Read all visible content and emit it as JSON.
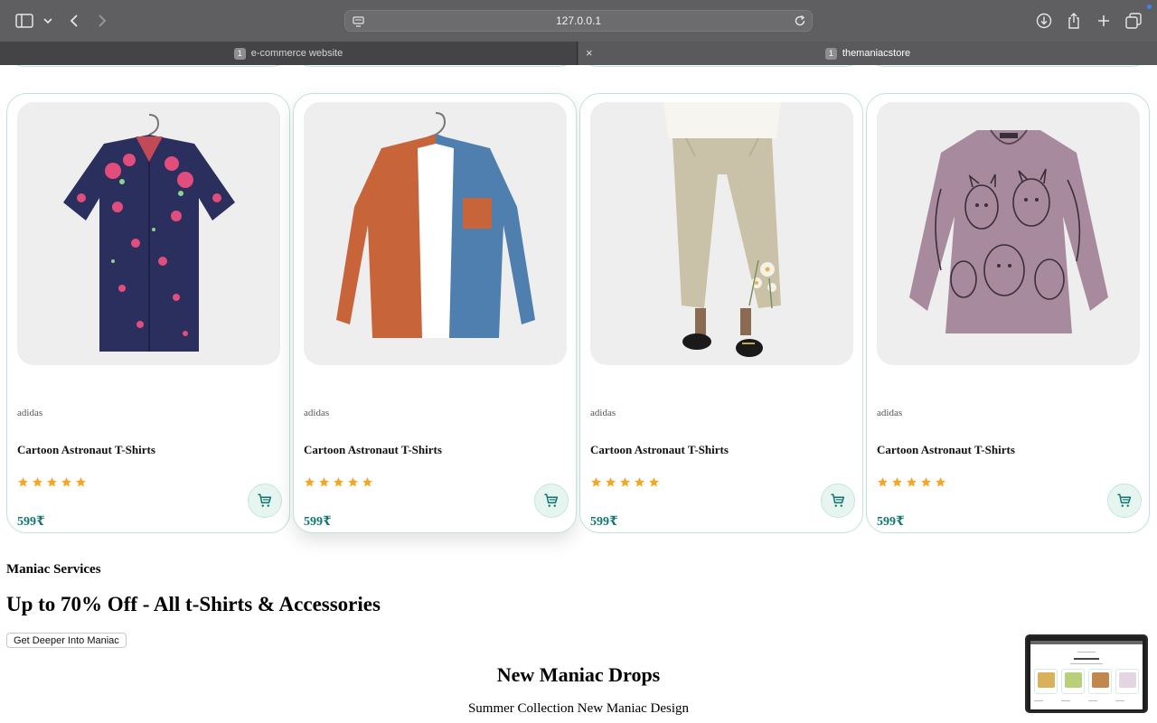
{
  "browser": {
    "url": "127.0.0.1",
    "tabs": [
      {
        "number": "1",
        "label": "e-commerce website",
        "active": false
      },
      {
        "number": "1",
        "label": "themaniacstore",
        "active": true
      }
    ],
    "tab_close_glyph": "×"
  },
  "products": [
    {
      "brand": "adidas",
      "title": "Cartoon Astronaut T-Shirts",
      "price": "599₹",
      "rating": 5,
      "image": "floral-shirt-icon"
    },
    {
      "brand": "adidas",
      "title": "Cartoon Astronaut T-Shirts",
      "price": "599₹",
      "rating": 5,
      "image": "colorblock-shirt-icon"
    },
    {
      "brand": "adidas",
      "title": "Cartoon Astronaut T-Shirts",
      "price": "599₹",
      "rating": 5,
      "image": "linen-pants-icon"
    },
    {
      "brand": "adidas",
      "title": "Cartoon Astronaut T-Shirts",
      "price": "599₹",
      "rating": 5,
      "image": "cat-print-blouse-icon"
    }
  ],
  "services": {
    "heading": "Maniac Services",
    "promo": "Up to 70% Off - All t-Shirts & Accessories",
    "cta_label": "Get Deeper Into Maniac"
  },
  "drops": {
    "title": "New Maniac Drops",
    "subtitle": "Summer Collection New Maniac Design"
  },
  "colors": {
    "accent": "#0f766e",
    "star": "#f5a623",
    "card_border": "#bfe3d8",
    "cart_bg": "#e6f5ef"
  }
}
